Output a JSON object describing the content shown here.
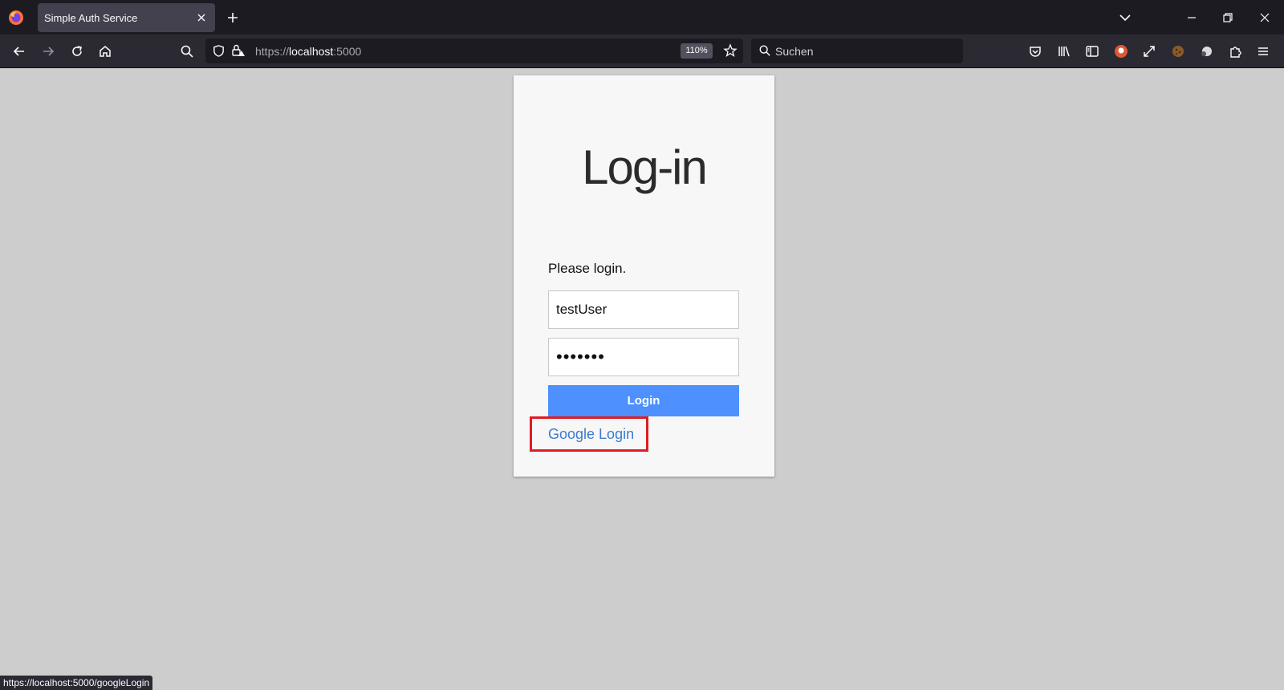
{
  "browser": {
    "tab_title": "Simple Auth Service",
    "url_scheme": "https://",
    "url_host": "localhost",
    "url_port": ":5000",
    "zoom": "110%",
    "search_placeholder": "Suchen",
    "status_url": "https://localhost:5000/googleLogin"
  },
  "login": {
    "title": "Log-in",
    "prompt": "Please login.",
    "username_value": "testUser",
    "password_value": "•••••••",
    "login_button": "Login",
    "google_login": "Google Login"
  },
  "colors": {
    "page_bg": "#cdcdcd",
    "card_bg": "#f7f7f7",
    "login_button": "#4d90fe",
    "google_link": "#3d7bd1",
    "highlight": "#e11b22"
  }
}
